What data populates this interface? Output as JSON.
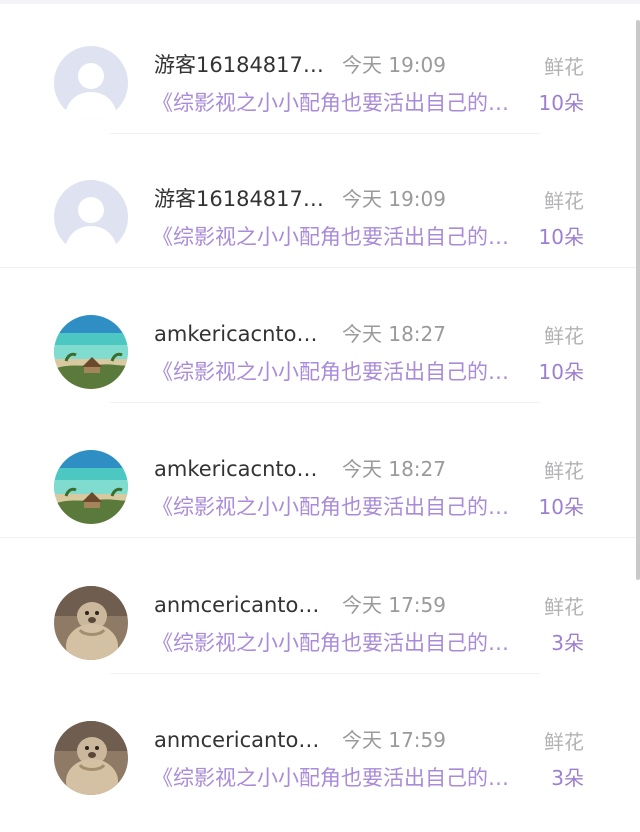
{
  "records": [
    {
      "username": "游客16184817…",
      "time": "今天 19:09",
      "gift_label": "鲜花",
      "book": "《综影视之小小配角也要活出自己的…",
      "count": "10朵",
      "avatar": "default-avatar"
    },
    {
      "username": "游客16184817…",
      "time": "今天 19:09",
      "gift_label": "鲜花",
      "book": "《综影视之小小配角也要活出自己的…",
      "count": "10朵",
      "avatar": "default-avatar"
    },
    {
      "username": "amkericacnto…",
      "time": "今天 18:27",
      "gift_label": "鲜花",
      "book": "《综影视之小小配角也要活出自己的…",
      "count": "10朵",
      "avatar": "beach-avatar"
    },
    {
      "username": "amkericacnto…",
      "time": "今天 18:27",
      "gift_label": "鲜花",
      "book": "《综影视之小小配角也要活出自己的…",
      "count": "10朵",
      "avatar": "beach-avatar"
    },
    {
      "username": "anmcericanto…",
      "time": "今天 17:59",
      "gift_label": "鲜花",
      "book": "《综影视之小小配角也要活出自己的…",
      "count": "3朵",
      "avatar": "animal-avatar"
    },
    {
      "username": "anmcericanto…",
      "time": "今天 17:59",
      "gift_label": "鲜花",
      "book": "《综影视之小小配角也要活出自己的…",
      "count": "3朵",
      "avatar": "animal-avatar"
    }
  ],
  "colors": {
    "book_link": "#a98bd9",
    "count": "#9d7fd0",
    "username": "#333333",
    "time": "#9a9a9e",
    "gift_label": "#b3b3b6"
  }
}
